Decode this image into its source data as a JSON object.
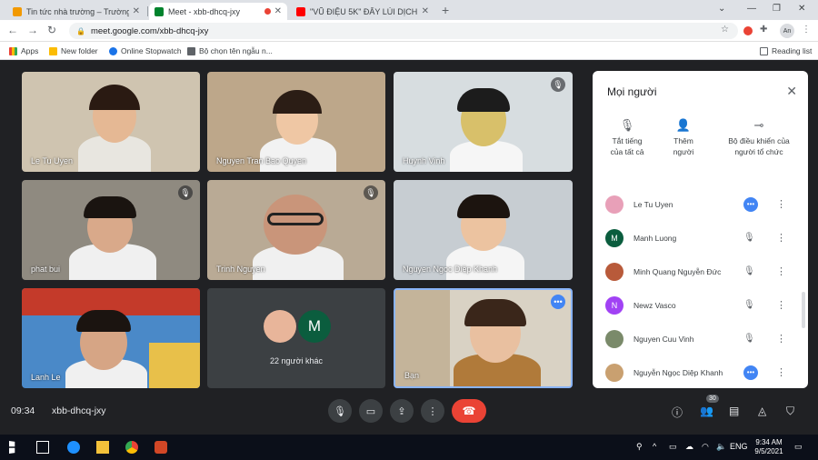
{
  "browser": {
    "tabs": [
      {
        "title": "Tin tức nhà trường – Trường Tiể...",
        "favicon_color": "#f29900"
      },
      {
        "title": "Meet - xbb-dhcq-jxy",
        "favicon_color": "#00832d"
      },
      {
        "title": "\"VŨ ĐIỆU 5K\" ĐẨY LÙI DỊCH BỆN...",
        "favicon_color": "#ff0000"
      }
    ],
    "url": "meet.google.com/xbb-dhcq-jxy",
    "bookmarks": [
      "Apps",
      "New folder",
      "Online Stopwatch",
      "Bộ chọn tên ngẫu n..."
    ],
    "reading_list": "Reading list",
    "profile": "An"
  },
  "tiles": [
    {
      "name": "Le Tu Uyen",
      "muted": false
    },
    {
      "name": "Nguyen Tran Bao Quyen",
      "muted": false
    },
    {
      "name": "Huynh Vinh",
      "muted": true
    },
    {
      "name": "phat bui",
      "muted": true
    },
    {
      "name": "Trinh Nguyen",
      "muted": true
    },
    {
      "name": "Nguyen Ngoc Diệp Khanh",
      "muted": false
    },
    {
      "name": "Lanh Le",
      "muted": false
    },
    {
      "name": "Bạn",
      "muted": false
    }
  ],
  "others": {
    "count_label": "22 người khác",
    "avatar_letter": "M"
  },
  "panel": {
    "title": "Mọi người",
    "actions": [
      {
        "label": "Tắt tiếng\ncủa tất cả",
        "icon": "mic-off-icon"
      },
      {
        "label": "Thêm\nngười",
        "icon": "add-person-icon"
      },
      {
        "label": "Bộ điều khiển của\nngười tổ chức",
        "icon": "toggle-icon"
      }
    ],
    "people": [
      {
        "name": "Le Tu Uyen",
        "letter": "",
        "avatar_color": "#e8a0b8",
        "status": "talking"
      },
      {
        "name": "Manh Luong",
        "letter": "M",
        "avatar_color": "#0b5d3e",
        "status": "muted"
      },
      {
        "name": "Minh Quang Nguyễn Đức",
        "letter": "",
        "avatar_color": "#b85a3a",
        "status": "muted"
      },
      {
        "name": "Newz Vasco",
        "letter": "N",
        "avatar_color": "#a142f4",
        "status": "muted"
      },
      {
        "name": "Nguyen Cuu Vinh",
        "letter": "",
        "avatar_color": "#7a8a6a",
        "status": "muted"
      },
      {
        "name": "Nguyễn Ngọc Diệp Khanh",
        "letter": "",
        "avatar_color": "#c9a070",
        "status": "talking"
      }
    ]
  },
  "meetbar": {
    "time": "09:34",
    "code": "xbb-dhcq-jxy",
    "participants_badge": "30"
  },
  "taskbar": {
    "lang": "ENG",
    "time": "9:34 AM",
    "date": "9/5/2021"
  }
}
